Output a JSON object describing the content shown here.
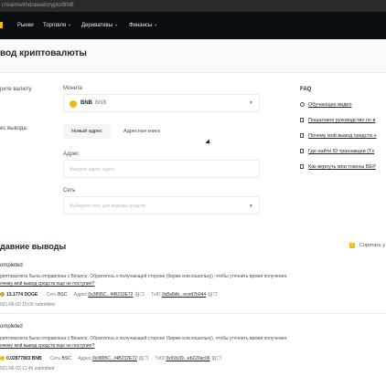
{
  "browser": {
    "url": "r/main/withdrawal/crypto/BNB"
  },
  "nav": {
    "items": [
      "Рынки",
      "Торговля",
      "Деривативы",
      "Финансы"
    ]
  },
  "page": {
    "title": "вод криптовалюты"
  },
  "form": {
    "step_label": "рите валюту",
    "coin_label": "Монета",
    "coin_value": "BNB",
    "coin_name": "BNB",
    "address_step_label": "ес вывода:",
    "tab_new": "Новый адрес",
    "tab_book": "Адресная книга",
    "address_label": "Адрес",
    "address_placeholder": "Введите адрес адрес",
    "network_label": "Сеть",
    "network_placeholder": "Выберите сеть для вывода средств"
  },
  "faq": {
    "title": "FAQ",
    "items": [
      "Обучающее видео",
      "Пошаговое руководство по в",
      "Почему мой вывод средств н",
      "Где найти ID транзакции (Tx",
      "Как вернуть мои токены BEP"
    ]
  },
  "recent": {
    "title": "давние выводы",
    "hide_label": "Спрятать у",
    "records": [
      {
        "status": "ompleted",
        "message": "риптовалюта была отправлена с Binance. Обратитесь к получающей стороне (бирже или кошельку), чтобы уточнить время получения.",
        "link": "очему мой вывод средств еще не поступил?",
        "amount": "13.1774 DOGE",
        "network_label": "Сеть",
        "network": "BSC",
        "address_label": "Адрес",
        "address": "0x3895C...f4B232E72",
        "txid_label": "TxID",
        "txid": "0x8a8db...eced7b044",
        "date": "021-06-03 15:09 submitted"
      },
      {
        "status": "ompleted",
        "message": "риптовалюта была отправлена с Binance. Обратитесь к получающей стороне (бирже или кошельку), чтобы уточнить время получения.",
        "link": "очему мой вывод средств еще не поступил?",
        "amount": "0.02877803 BNB",
        "network_label": "Сеть",
        "network": "BSC",
        "address_label": "Адрес",
        "address": "0x3895C...f4B232E72",
        "txid_label": "TxID",
        "txid": "0x91b39...eb220ac06",
        "date": "021-06-03 11:46 submitted"
      }
    ]
  }
}
